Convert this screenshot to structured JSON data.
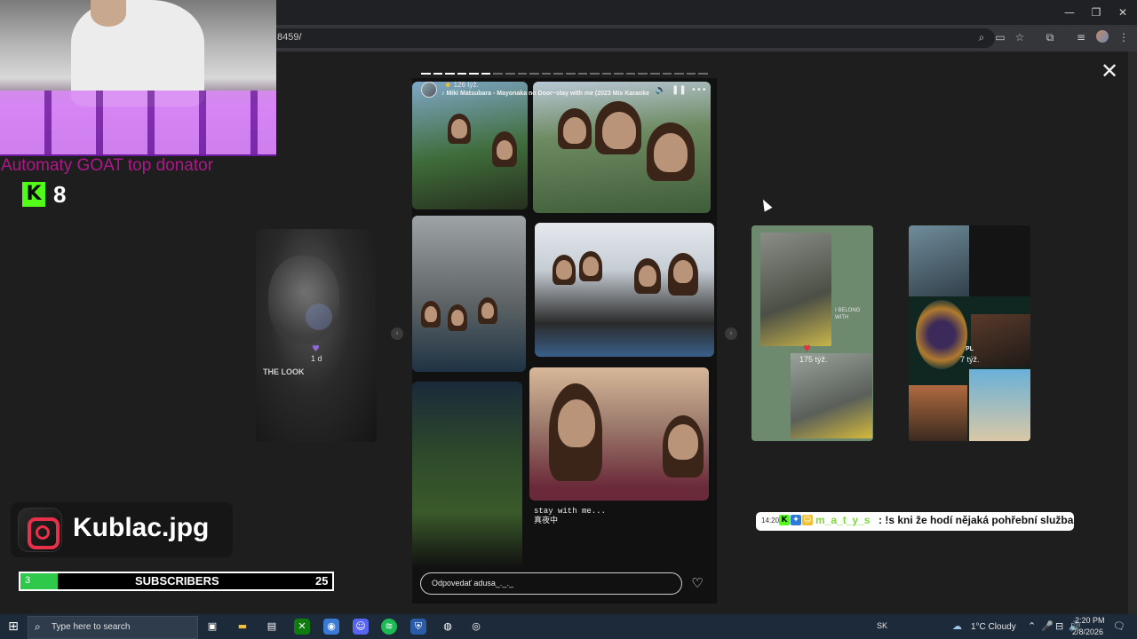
{
  "browser": {
    "url": "8459/",
    "window_controls": [
      "—",
      "❐",
      "✕"
    ]
  },
  "stream_overlay": {
    "donator_text": "Automaty GOAT top donator",
    "kick_count": "8",
    "instagram_handle": "Kublac.jpg",
    "subs": {
      "current": "3",
      "label": "SUBSCRIBERS",
      "goal": "25",
      "progress_fraction": 0.12
    }
  },
  "story": {
    "time_ago": "126 týž.",
    "song": "Miki Matsubara - Mayonaka no Door~stay with me (2023 Mix Karaoke",
    "caption_line1": "stay with me...",
    "caption_line2": "真夜中",
    "reply_placeholder": "Odpovedať adusa_._._",
    "progress_segments": 24,
    "progress_done": 6
  },
  "side_stories": {
    "left": {
      "age": "1 d",
      "caption": "THE LOOK"
    },
    "right1": {
      "age": "175 týž.",
      "text": "I BELONG WITH"
    },
    "right2": {
      "age": "7 týž.",
      "label": "PL"
    }
  },
  "chat": {
    "time": "14:20",
    "user": "m_a_t_y_s",
    "message": ": !s kni že hodí nějaká pohřební služba",
    "badges": [
      {
        "glyph": "K",
        "color": "#53fc18"
      },
      {
        "glyph": "✦",
        "color": "#2d7bd8"
      },
      {
        "glyph": "☺",
        "color": "#f0c030"
      }
    ]
  },
  "taskbar": {
    "search_placeholder": "Type here to search",
    "lang": "SK",
    "weather": "1°C  Cloudy",
    "time": "2:20 PM",
    "date": "2/8/2026"
  },
  "colors": {
    "kick_green": "#53fc18",
    "donator_magenta": "#b0178c",
    "subs_green": "#2ec94a",
    "chat_user_green": "#7bd83a"
  }
}
